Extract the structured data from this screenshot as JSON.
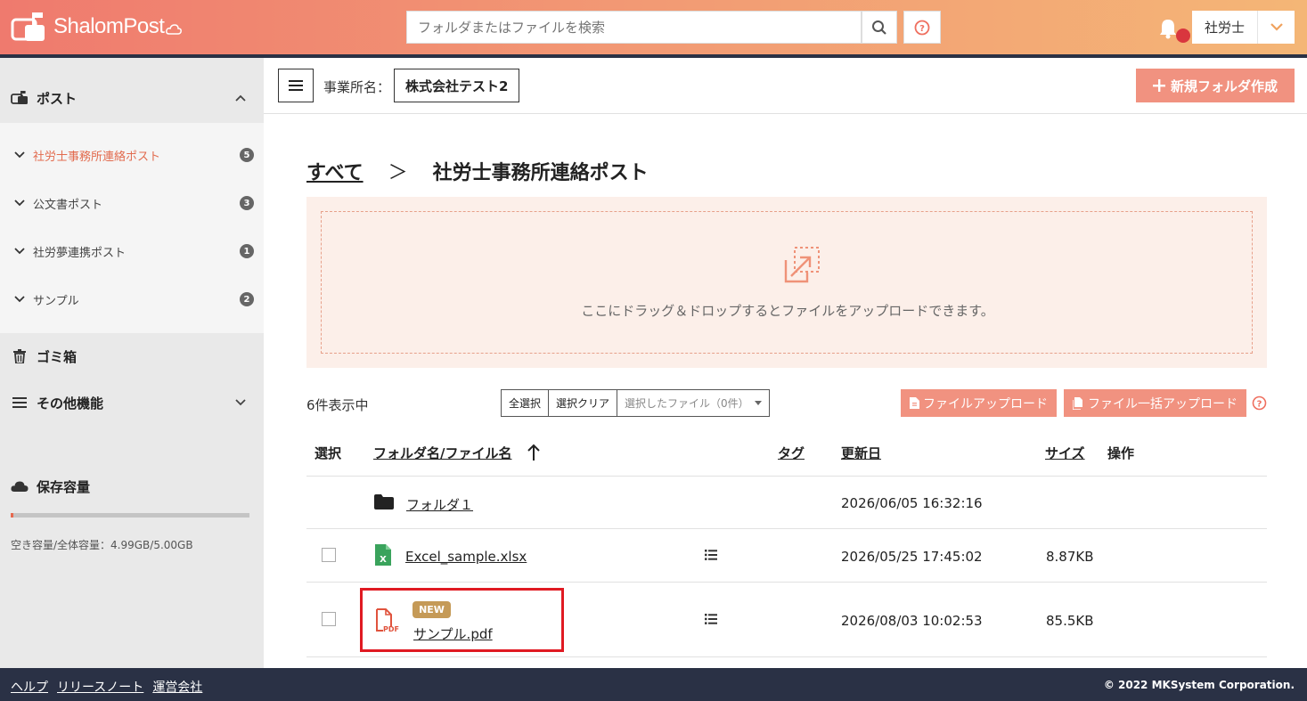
{
  "header": {
    "logo_text": "ShalomPost",
    "search_placeholder": "フォルダまたはファイルを検索",
    "user_name": "社労士",
    "accent": "#ef7a6e"
  },
  "sidebar": {
    "post_label": "ポスト",
    "items": [
      {
        "label": "社労士事務所連絡ポスト",
        "count": "5",
        "active": true
      },
      {
        "label": "公文書ポスト",
        "count": "3",
        "active": false
      },
      {
        "label": "社労夢連携ポスト",
        "count": "1",
        "active": false
      },
      {
        "label": "サンプル",
        "count": "2",
        "active": false
      }
    ],
    "trash_label": "ゴミ箱",
    "other_label": "その他機能",
    "storage_label": "保存容量",
    "storage_text": "空き容量/全体容量：4.99GB/5.00GB",
    "storage_used_fraction": 0.002
  },
  "toolbar": {
    "office_label": "事業所名：",
    "office_name": "株式会社テスト2",
    "new_folder_label": "新規フォルダ作成"
  },
  "breadcrumb": {
    "root": "すべて",
    "separator": "＞",
    "current": "社労士事務所連絡ポスト"
  },
  "dropzone": {
    "text": "ここにドラッグ＆ドロップするとファイルをアップロードできます。"
  },
  "actions": {
    "count_text": "6件表示中",
    "select_all": "全選択",
    "clear_selection": "選択クリア",
    "selected_files": "選択したファイル（0件）",
    "upload_label": "ファイルアップロード",
    "bulk_upload_label": "ファイル一括アップロード"
  },
  "table": {
    "headers": {
      "select": "選択",
      "name": "フォルダ名/ファイル名",
      "tag": "タグ",
      "updated": "更新日",
      "size": "サイズ",
      "ops": "操作"
    },
    "rows": [
      {
        "type": "folder",
        "name": "フォルダ１",
        "updated": "2026/06/05 16:32:16",
        "size": ""
      },
      {
        "type": "excel",
        "name": "Excel_sample.xlsx",
        "updated": "2026/05/25 17:45:02",
        "size": "8.87KB"
      },
      {
        "type": "pdf",
        "name": "サンプル.pdf",
        "updated": "2026/08/03 10:02:53",
        "size": "85.5KB",
        "badge": "NEW"
      }
    ]
  },
  "footer": {
    "links": [
      "ヘルプ",
      "リリースノート",
      "運営会社"
    ],
    "copyright": "© 2022 MKSystem Corporation."
  }
}
